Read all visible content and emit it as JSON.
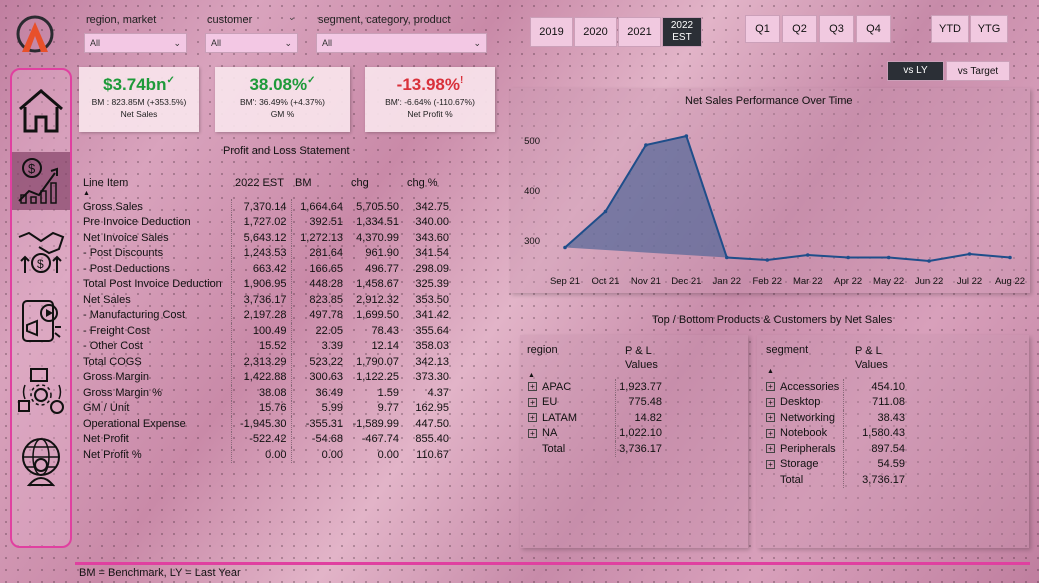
{
  "filters": [
    {
      "label": "region, market",
      "value": "All"
    },
    {
      "label": "customer",
      "value": "All"
    },
    {
      "label": "segment, category, product",
      "value": "All"
    }
  ],
  "years": [
    "2019",
    "2020",
    "2021",
    "2022 EST"
  ],
  "quarters": [
    "Q1",
    "Q2",
    "Q3",
    "Q4"
  ],
  "ytd": [
    "YTD",
    "YTG"
  ],
  "compare": [
    "vs LY",
    "vs Target"
  ],
  "kpis": [
    {
      "value": "$3.74bn",
      "mark": "✓",
      "bm": "BM : 823.85M (+353.5%)",
      "name": "Net Sales",
      "color": "#1e9a3a"
    },
    {
      "value": "38.08%",
      "mark": "✓",
      "bm": "BM': 36.49% (+4.37%)",
      "name": "GM %",
      "color": "#1e9a3a"
    },
    {
      "value": "-13.98%",
      "mark": "!",
      "bm": "BM': -6.64% (-110.67%)",
      "name": "Net Profit %",
      "color": "#d9303a"
    }
  ],
  "pl": {
    "title": "Profit and Loss Statement",
    "headers": [
      "Line Item",
      "2022 EST",
      "BM",
      "chg",
      "chg %"
    ],
    "rows": [
      [
        "Gross Sales",
        "7,370.14",
        "1,664.64",
        "5,705.50",
        "342.75"
      ],
      [
        "Pre Invoice Deduction",
        "1,727.02",
        "392.51",
        "1,334.51",
        "340.00"
      ],
      [
        "Net Invoice Sales",
        "5,643.12",
        "1,272.13",
        "4,370.99",
        "343.60"
      ],
      [
        "- Post Discounts",
        "1,243.53",
        "281.64",
        "961.90",
        "341.54"
      ],
      [
        "- Post Deductions",
        "663.42",
        "166.65",
        "496.77",
        "298.09"
      ],
      [
        "Total Post Invoice Deduction",
        "1,906.95",
        "448.28",
        "1,458.67",
        "325.39"
      ],
      [
        "Net Sales",
        "3,736.17",
        "823.85",
        "2,912.32",
        "353.50"
      ],
      [
        "- Manufacturing Cost",
        "2,197.28",
        "497.78",
        "1,699.50",
        "341.42"
      ],
      [
        "- Freight Cost",
        "100.49",
        "22.05",
        "78.43",
        "355.64"
      ],
      [
        "- Other Cost",
        "15.52",
        "3.39",
        "12.14",
        "358.03"
      ],
      [
        "Total COGS",
        "2,313.29",
        "523.22",
        "1,790.07",
        "342.13"
      ],
      [
        "Gross Margin",
        "1,422.88",
        "300.63",
        "1,122.25",
        "373.30"
      ],
      [
        "Gross Margin %",
        "38.08",
        "36.49",
        "1.59",
        "4.37"
      ],
      [
        "GM / Unit",
        "15.76",
        "5.99",
        "9.77",
        "162.95"
      ],
      [
        "Operational Expense",
        "-1,945.30",
        "-355.31",
        "-1,589.99",
        "447.50"
      ],
      [
        "Net Profit",
        "-522.42",
        "-54.68",
        "-467.74",
        "855.40"
      ],
      [
        "Net Profit %",
        "0.00",
        "0.00",
        "0.00",
        "110.67"
      ]
    ]
  },
  "chart_data": {
    "type": "area",
    "title": "Net Sales Performance Over Time",
    "categories": [
      "Sep 21",
      "Oct 21",
      "Nov 21",
      "Dec 21",
      "Jan 22",
      "Feb 22",
      "Mar 22",
      "Apr 22",
      "May 22",
      "Jun 22",
      "Jul 22",
      "Aug 22"
    ],
    "x": [
      "Sep 21",
      "Oct 21",
      "Nov 21",
      "Dec 21",
      "Jan 22",
      "Feb 22",
      "Mar 22",
      "Apr 22",
      "May 22",
      "Jun 22",
      "Jul 22",
      "Aug 22"
    ],
    "values": [
      285,
      357,
      490,
      508,
      265,
      260,
      270,
      265,
      265,
      258,
      272,
      265
    ],
    "extra_points": [
      {
        "x": "Oct 21 mid",
        "y": 318
      },
      {
        "x": "Dec 21 mid",
        "y": 380
      }
    ],
    "yticks": [
      300,
      400,
      500
    ],
    "ylim": [
      240,
      530
    ],
    "color": "#1f4e8a",
    "fill": "#5a6a9a"
  },
  "topbottom": {
    "title": "Top / Bottom Products & Customers by Net Sales",
    "region": {
      "h1": "region",
      "h2": "P & L",
      "h3": "Values",
      "rows": [
        [
          "APAC",
          "1,923.77"
        ],
        [
          "EU",
          "775.48"
        ],
        [
          "LATAM",
          "14.82"
        ],
        [
          "NA",
          "1,022.10"
        ]
      ],
      "total": [
        "Total",
        "3,736.17"
      ]
    },
    "segment": {
      "h1": "segment",
      "h2": "P & L",
      "h3": "Values",
      "rows": [
        [
          "Accessories",
          "454.10"
        ],
        [
          "Desktop",
          "711.08"
        ],
        [
          "Networking",
          "38.43"
        ],
        [
          "Notebook",
          "1,580.43"
        ],
        [
          "Peripherals",
          "897.54"
        ],
        [
          "Storage",
          "54.59"
        ]
      ],
      "total": [
        "Total",
        "3,736.17"
      ]
    }
  },
  "footer": "BM = Benchmark, LY = Last Year",
  "nav": [
    "home-icon",
    "finance-chart-icon",
    "sales-handshake-icon",
    "marketing-megaphone-icon",
    "supply-chain-icon",
    "executive-globe-icon"
  ]
}
